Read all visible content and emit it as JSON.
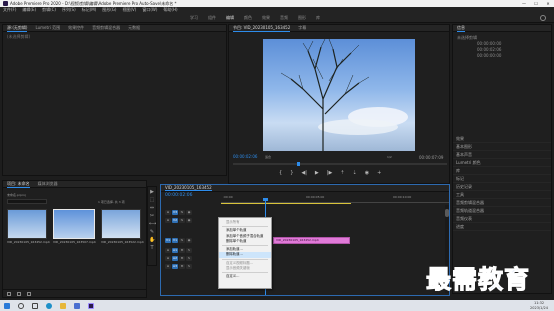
{
  "window": {
    "title": "Adobe Premiere Pro 2020 - D:\\视频\\剪辑\\编辑\\Adobe Premiere Pro Auto-Save\\未命名 *",
    "minimize": "—",
    "maximize": "☐",
    "close": "✕"
  },
  "menu": [
    "文件(F)",
    "编辑(E)",
    "剪辑(C)",
    "序列(S)",
    "标记(M)",
    "图形(G)",
    "视图(V)",
    "窗口(W)",
    "帮助(H)"
  ],
  "workspaces": {
    "items": [
      "学习",
      "组件",
      "编辑",
      "颜色",
      "效果",
      "音频",
      "图形",
      "库"
    ],
    "active_index": 2
  },
  "source_panel": {
    "tabs": [
      "源:(无剪辑)",
      "Lumetri 范围",
      "效果控件",
      "音频剪辑混合器",
      "元数据"
    ],
    "placeholder": "(未选择剪辑)"
  },
  "program_monitor": {
    "tabs": [
      "节目: VID_20230105_163452",
      "字幕"
    ],
    "timecode": "00:00:02:06",
    "fit": "适合",
    "quality": "1/2",
    "duration": "00:00:07:09"
  },
  "project_panel": {
    "tabs": [
      "项目: 未命名",
      "媒体浏览器"
    ],
    "project_file": "未命名.prproj",
    "selection": "1 项已选择, 共 3 项",
    "items": [
      {
        "name": "VID_20230105_163452.mp4",
        "duration": "7:09"
      },
      {
        "name": "VID_20230105_163507.mp4",
        "duration": "6:12"
      },
      {
        "name": "VID_20230105_163522.mp4",
        "duration": "5:22"
      }
    ]
  },
  "tools": [
    "▶",
    "⬚",
    "⇔",
    "✂",
    "⟷",
    "✎",
    "✋",
    "T"
  ],
  "timeline": {
    "tab": "VID_20230105_163452",
    "timecode": "00:00:02:06",
    "ruler": [
      ":00:00",
      "00:00:05:00",
      "00:00:10:00"
    ],
    "video_tracks": [
      "V3",
      "V2",
      "V1"
    ],
    "audio_tracks": [
      "A1",
      "A2",
      "A3"
    ],
    "clip_label": "VID_20230105_163452.mp4"
  },
  "context_menu": {
    "items": [
      {
        "label": "显示所有",
        "state": "disabled"
      },
      {
        "label": "---"
      },
      {
        "label": "添加单个轨道",
        "state": "normal"
      },
      {
        "label": "添加单个音频子混合轨道",
        "state": "normal"
      },
      {
        "label": "删除单个轨道",
        "state": "normal"
      },
      {
        "label": "---"
      },
      {
        "label": "添加轨道...",
        "state": "normal"
      },
      {
        "label": "删除轨道...",
        "state": "highlighted"
      },
      {
        "label": "---"
      },
      {
        "label": "自定义视频标题...",
        "state": "disabled"
      },
      {
        "label": "显示音频关键帧",
        "state": "disabled"
      },
      {
        "label": "---"
      },
      {
        "label": "自定义...",
        "state": "normal"
      }
    ]
  },
  "right_panel": {
    "title": "信息",
    "lines": [
      "未选择剪辑",
      "00:00:00:00",
      "00:00:02:06",
      "00:00:00:00"
    ],
    "items": [
      "效果",
      "基本图形",
      "基本声音",
      "Lumetri 颜色",
      "库",
      "标记",
      "历史记录",
      "工具",
      "音频剪辑混合器",
      "音频轨道混合器",
      "音频仪表",
      "进度"
    ]
  },
  "taskbar": {
    "time": "11:32",
    "date": "2023/1/24",
    "icons": [
      "windows-start-icon",
      "search-icon",
      "task-view-icon",
      "edge-icon",
      "explorer-icon",
      "store-icon",
      "premiere-icon"
    ]
  },
  "watermark": "最需教育"
}
